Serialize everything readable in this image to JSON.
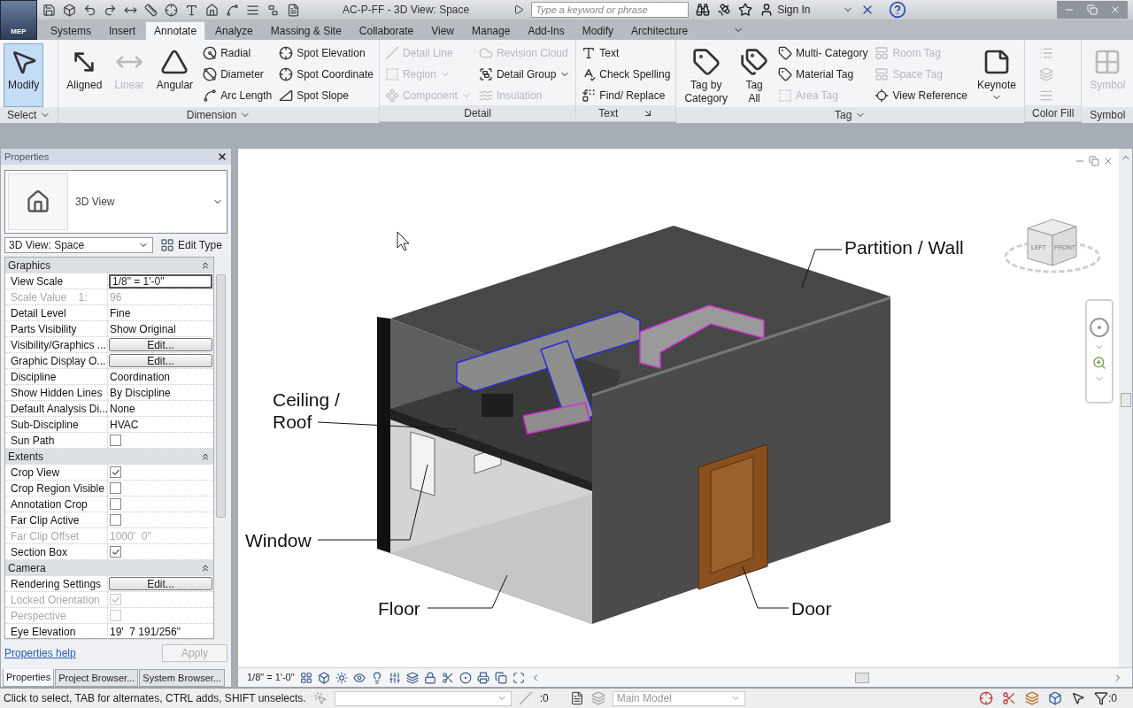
{
  "title_bar": {
    "app_badge": "MEP",
    "title": "AC-P-FF - 3D View: Space",
    "search_placeholder": "Type a keyword or phrase",
    "sign_in": "Sign In"
  },
  "tabs": [
    {
      "label": "Systems",
      "selected": false
    },
    {
      "label": "Insert",
      "selected": false
    },
    {
      "label": "Annotate",
      "selected": true
    },
    {
      "label": "Analyze",
      "selected": false
    },
    {
      "label": "Massing & Site",
      "selected": false
    },
    {
      "label": "Collaborate",
      "selected": false
    },
    {
      "label": "View",
      "selected": false
    },
    {
      "label": "Manage",
      "selected": false
    },
    {
      "label": "Add-Ins",
      "selected": false
    },
    {
      "label": "Modify",
      "selected": false
    },
    {
      "label": "Architecture",
      "selected": false
    }
  ],
  "ribbon": [
    {
      "title": "Select",
      "dropdown": true,
      "columns": [
        [
          {
            "label": "Modify",
            "kind": "large",
            "disabled": false,
            "active": true
          }
        ]
      ]
    },
    {
      "title": "Dimension",
      "dropdown": true,
      "columns": [
        [
          {
            "label": "Aligned",
            "kind": "large",
            "disabled": false,
            "active": false
          }
        ],
        [
          {
            "label": "Linear",
            "kind": "large",
            "disabled": true,
            "active": false
          }
        ],
        [
          {
            "label": "Angular",
            "kind": "large",
            "disabled": false,
            "active": false
          }
        ],
        [
          {
            "label": "Radial",
            "kind": "small",
            "disabled": false
          },
          {
            "label": "Diameter",
            "kind": "small",
            "disabled": false
          },
          {
            "label": "Arc Length",
            "kind": "small",
            "disabled": false
          }
        ],
        [
          {
            "label": "Spot Elevation",
            "kind": "small",
            "disabled": false
          },
          {
            "label": "Spot Coordinate",
            "kind": "small",
            "disabled": false
          },
          {
            "label": "Spot Slope",
            "kind": "small",
            "disabled": false
          }
        ]
      ]
    },
    {
      "title": "Detail",
      "columns": [
        [
          {
            "label": "Detail Line",
            "kind": "small",
            "disabled": true
          },
          {
            "label": "Region",
            "kind": "small",
            "disabled": true,
            "dropdown": true
          },
          {
            "label": "Component",
            "kind": "small",
            "disabled": true,
            "dropdown": true
          }
        ],
        [
          {
            "label": "Revision Cloud",
            "kind": "small",
            "disabled": true
          },
          {
            "label": "Detail Group",
            "kind": "small",
            "disabled": false,
            "dropdown": true
          },
          {
            "label": "Insulation",
            "kind": "small",
            "disabled": true
          }
        ]
      ]
    },
    {
      "title": "Text",
      "launcher": true,
      "columns": [
        [
          {
            "label": "Text",
            "kind": "small",
            "disabled": false
          },
          {
            "label": "Check Spelling",
            "kind": "small",
            "disabled": false
          },
          {
            "label": "Find/ Replace",
            "kind": "small",
            "disabled": false
          }
        ]
      ]
    },
    {
      "title": "Tag",
      "dropdown": true,
      "columns": [
        [
          {
            "label": "Tag by Category",
            "kind": "large",
            "disabled": false,
            "active": false
          }
        ],
        [
          {
            "label": "Tag All",
            "kind": "large",
            "disabled": false,
            "active": false
          }
        ],
        [
          {
            "label": "Multi- Category",
            "kind": "small",
            "disabled": false
          },
          {
            "label": "Material Tag",
            "kind": "small",
            "disabled": false
          },
          {
            "label": "Area Tag",
            "kind": "small",
            "disabled": true
          }
        ],
        [
          {
            "label": "Room Tag",
            "kind": "small",
            "disabled": true
          },
          {
            "label": "Space Tag",
            "kind": "small",
            "disabled": true
          },
          {
            "label": "View Reference",
            "kind": "small",
            "disabled": false
          }
        ],
        [
          {
            "label": "Keynote",
            "kind": "large",
            "disabled": false,
            "active": false,
            "dropdown": true
          }
        ]
      ]
    },
    {
      "title": "Color Fill",
      "columns": [
        [
          {
            "kind": "icon",
            "disabled": true
          },
          {
            "kind": "icon",
            "disabled": true
          },
          {
            "kind": "icon",
            "disabled": true
          }
        ]
      ]
    },
    {
      "title": "Symbol",
      "columns": [
        [
          {
            "label": "Symbol",
            "kind": "large",
            "disabled": true,
            "active": false
          }
        ]
      ]
    }
  ],
  "properties": {
    "title": "Properties",
    "type_name": "3D View",
    "selector": "3D View: Space",
    "edit_type": "Edit Type",
    "groups": [
      {
        "name": "Graphics",
        "expanded": true,
        "rows": [
          {
            "label": "View Scale",
            "kind": "field",
            "value": "1/8\" = 1'-0\"",
            "disabled": false
          },
          {
            "label": "Scale Value    1:",
            "kind": "text",
            "value": "96",
            "disabled": true
          },
          {
            "label": "Detail Level",
            "kind": "text",
            "value": "Fine",
            "disabled": false
          },
          {
            "label": "Parts Visibility",
            "kind": "text",
            "value": "Show Original",
            "disabled": false
          },
          {
            "label": "Visibility/Graphics ...",
            "kind": "button",
            "value": "Edit...",
            "disabled": false
          },
          {
            "label": "Graphic Display O...",
            "kind": "button",
            "value": "Edit...",
            "disabled": false
          },
          {
            "label": "Discipline",
            "kind": "text",
            "value": "Coordination",
            "disabled": false
          },
          {
            "label": "Show Hidden Lines",
            "kind": "text",
            "value": "By Discipline",
            "disabled": false
          },
          {
            "label": "Default Analysis Di...",
            "kind": "text",
            "value": "None",
            "disabled": false
          },
          {
            "label": "Sub-Discipline",
            "kind": "text",
            "value": "HVAC",
            "disabled": false
          },
          {
            "label": "Sun Path",
            "kind": "checkbox",
            "checked": false,
            "disabled": false
          }
        ]
      },
      {
        "name": "Extents",
        "expanded": true,
        "rows": [
          {
            "label": "Crop View",
            "kind": "checkbox",
            "checked": true,
            "disabled": false
          },
          {
            "label": "Crop Region Visible",
            "kind": "checkbox",
            "checked": false,
            "disabled": false
          },
          {
            "label": "Annotation Crop",
            "kind": "checkbox",
            "checked": false,
            "disabled": false
          },
          {
            "label": "Far Clip Active",
            "kind": "checkbox",
            "checked": false,
            "disabled": false
          },
          {
            "label": "Far Clip Offset",
            "kind": "text",
            "value": "1000'  0\"",
            "disabled": true
          },
          {
            "label": "Section Box",
            "kind": "checkbox",
            "checked": true,
            "disabled": false
          }
        ]
      },
      {
        "name": "Camera",
        "expanded": true,
        "rows": [
          {
            "label": "Rendering Settings",
            "kind": "button",
            "value": "Edit...",
            "disabled": false
          },
          {
            "label": "Locked Orientation",
            "kind": "checkbox",
            "checked": true,
            "disabled": true
          },
          {
            "label": "Perspective",
            "kind": "checkbox",
            "checked": false,
            "disabled": true
          },
          {
            "label": "Eye Elevation",
            "kind": "text",
            "value": "19'  7 191/256\"",
            "disabled": false
          }
        ]
      }
    ],
    "help": "Properties help",
    "apply": "Apply"
  },
  "browser_tabs": [
    {
      "label": "Properties",
      "selected": true
    },
    {
      "label": "Project Browser...",
      "selected": false
    },
    {
      "label": "System Browser...",
      "selected": false
    }
  ],
  "viewport": {
    "labels": [
      {
        "text": "Partition / Wall"
      },
      {
        "text": "Ceiling / Roof"
      },
      {
        "text": "Window"
      },
      {
        "text": "Floor"
      },
      {
        "text": "Door"
      }
    ],
    "view_cube": [
      "LEFT",
      "FRONT"
    ],
    "scale": "1/8\" = 1'-0\""
  },
  "status_bar": {
    "message": "Click to select, TAB for alternates, CTRL adds, SHIFT unselects.",
    "count": ":0",
    "model": "Main Model",
    "filter_count": ":0"
  }
}
